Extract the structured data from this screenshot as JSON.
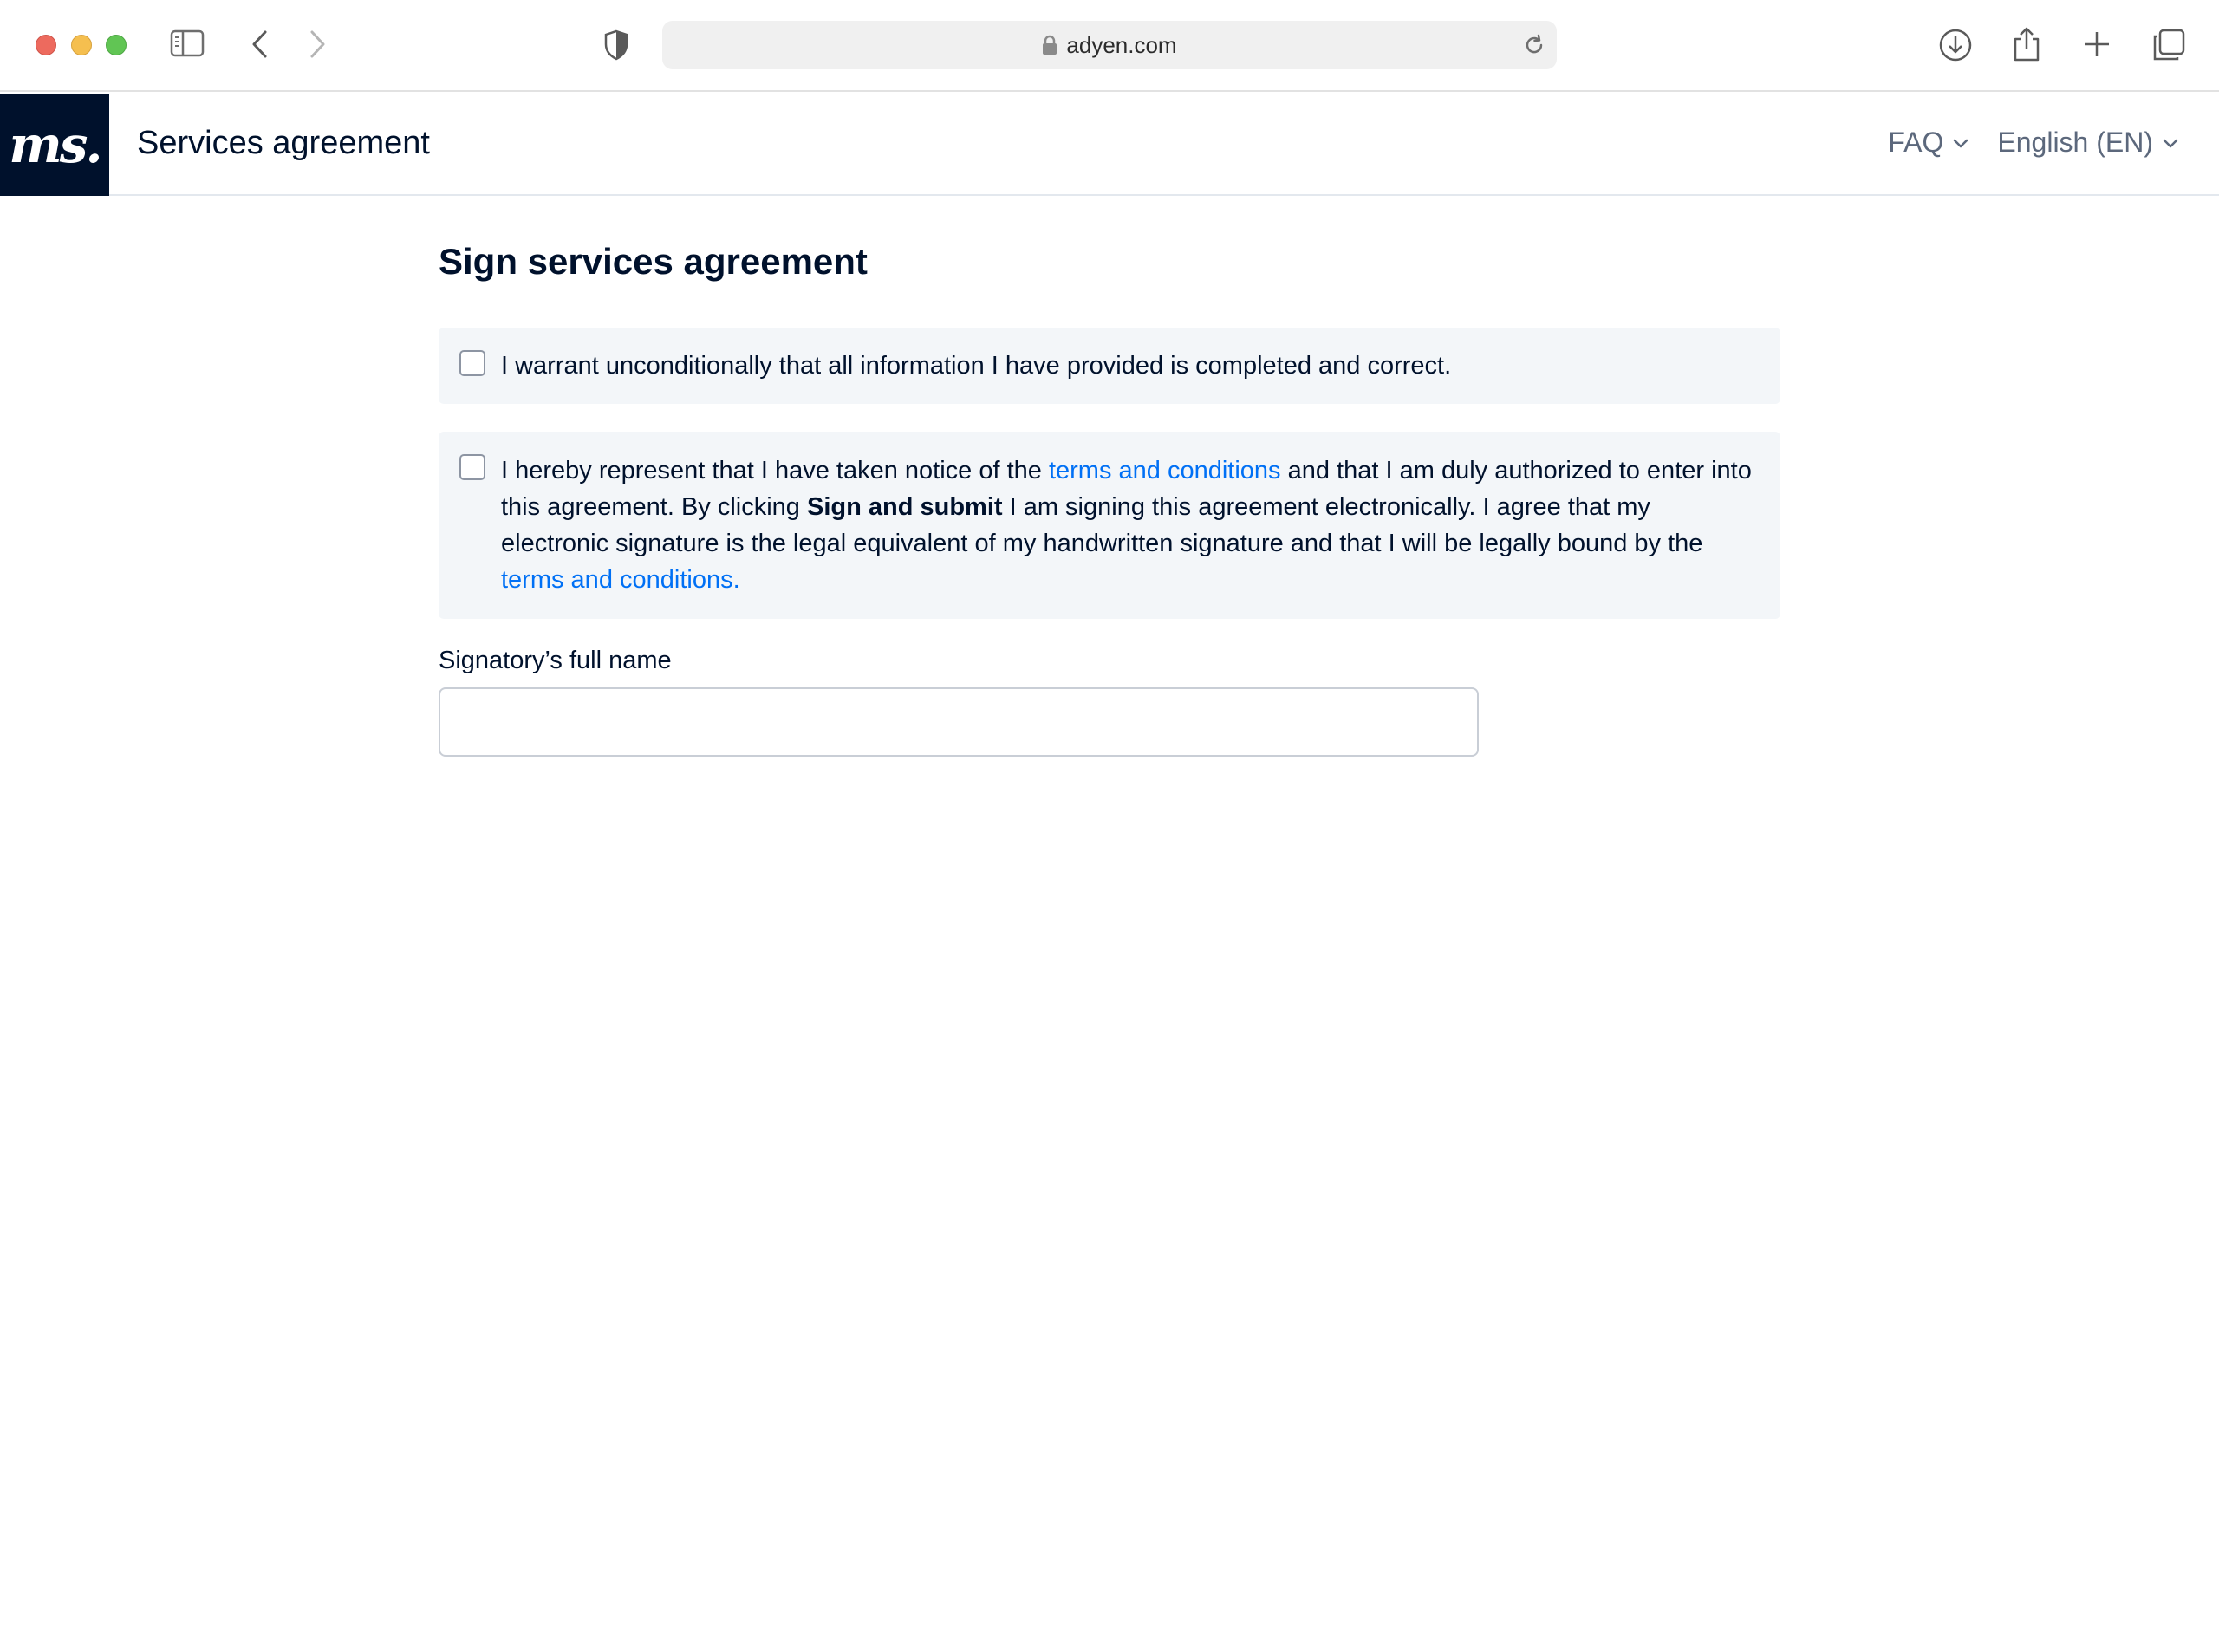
{
  "browser": {
    "url": "adyen.com",
    "icons": [
      "sidebar-icon",
      "back-icon",
      "forward-icon",
      "shield-icon",
      "lock-icon",
      "reload-icon",
      "download-icon",
      "share-icon",
      "new-tab-icon",
      "tabs-overview-icon"
    ]
  },
  "header": {
    "logo_text": "ms.",
    "title": "Services agreement",
    "nav": {
      "faq_label": "FAQ",
      "language_label": "English (EN)"
    }
  },
  "main": {
    "heading": "Sign services agreement",
    "warranty": {
      "text": "I warrant unconditionally that all information I have provided is completed and correct."
    },
    "agreement": {
      "text_1": "I hereby represent that I have taken notice of the ",
      "link_1": "terms and conditions",
      "text_2": " and that I am duly authorized to enter into this agreement. By clicking ",
      "bold": "Sign and submit",
      "text_3": " I am signing this agreement electronically. I agree that my electronic signature is the legal equivalent of my handwritten signature and that I will be legally bound by the ",
      "link_2": "terms and conditions."
    },
    "signatory": {
      "label": "Signatory’s full name",
      "value": ""
    }
  },
  "colors": {
    "brand_dark": "#00112c",
    "link": "#0070f5",
    "card_bg": "#f3f6f9"
  }
}
